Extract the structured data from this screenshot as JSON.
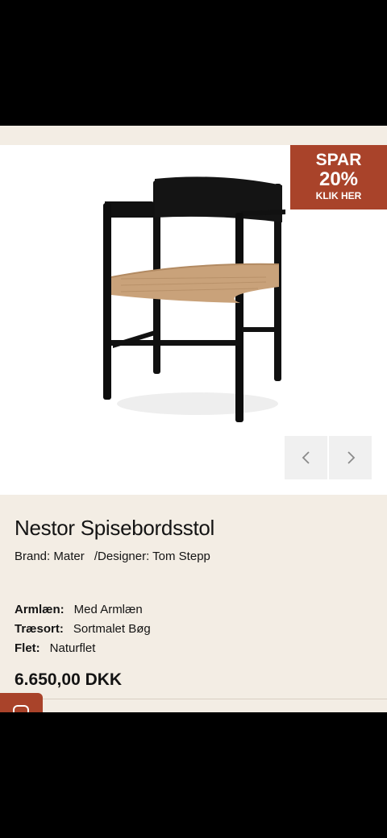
{
  "promo": {
    "line1": "SPAR",
    "line2": "20%",
    "line3": "KLIK HER"
  },
  "product": {
    "title": "Nestor Spisebordsstol",
    "brand_label": "Brand:",
    "brand": "Mater",
    "designer_label": "/Designer:",
    "designer": "Tom Stepp",
    "specs": [
      {
        "key": "Armlæn:",
        "value": "Med Armlæn"
      },
      {
        "key": "Træsort:",
        "value": "Sortmalet Bøg"
      },
      {
        "key": "Flet:",
        "value": "Naturflet"
      }
    ],
    "price": "6.650,00 DKK"
  },
  "gallery": {
    "prev_icon": "chevron-left-icon",
    "next_icon": "chevron-right-icon"
  },
  "chat": {
    "icon": "chat-icon"
  },
  "colors": {
    "accent": "#a9432a",
    "background": "#f3ede4"
  }
}
